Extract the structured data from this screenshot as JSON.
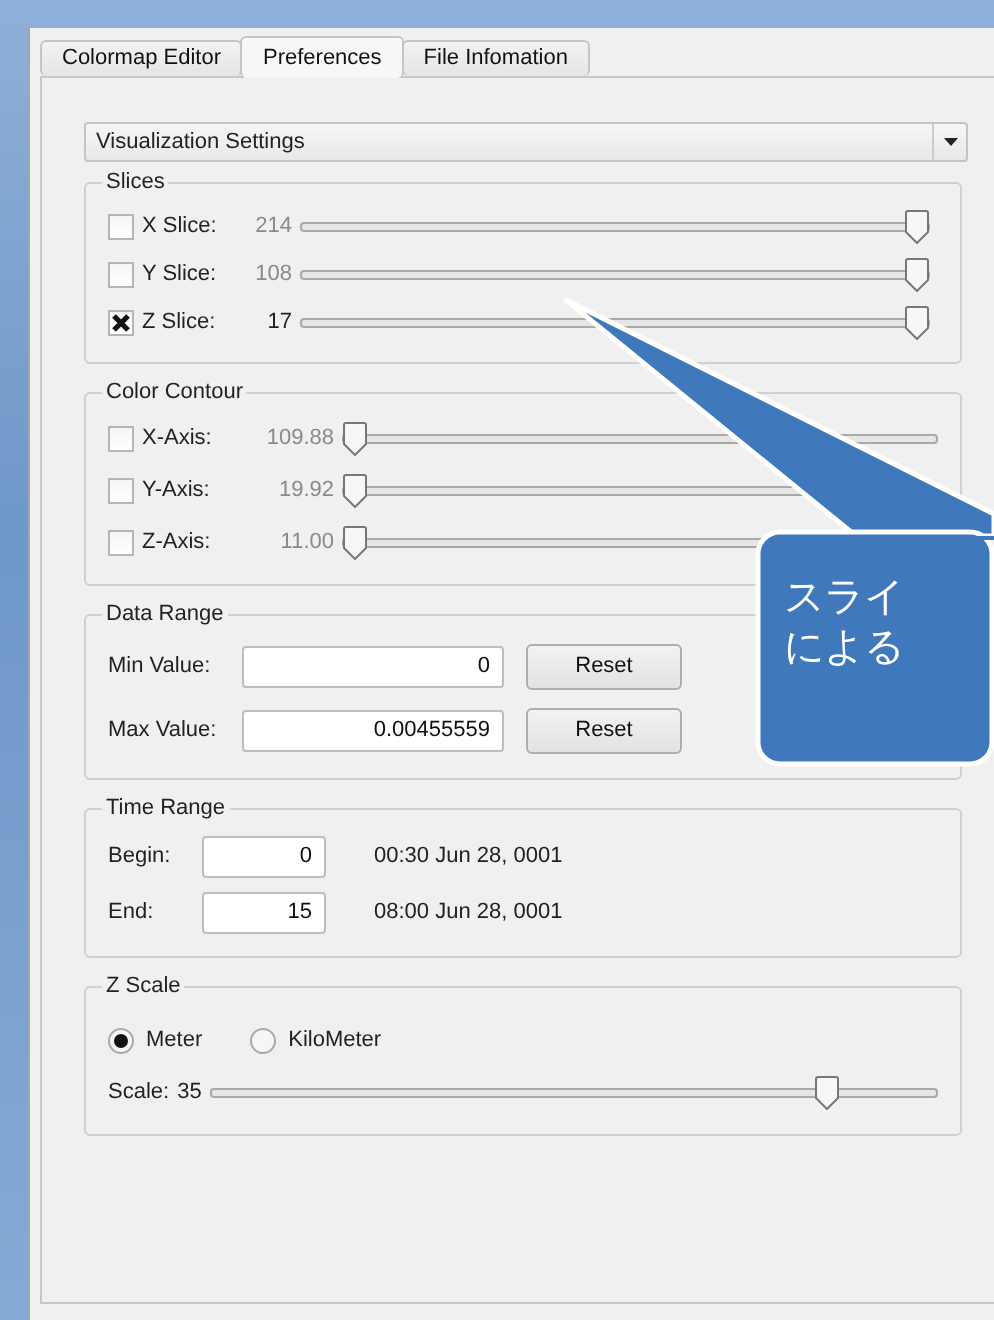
{
  "tabs": [
    {
      "label": "Colormap Editor",
      "selected": false
    },
    {
      "label": "Preferences",
      "selected": true
    },
    {
      "label": "File Infomation",
      "selected": false
    }
  ],
  "dropdown": {
    "value": "Visualization Settings"
  },
  "slices": {
    "title": "Slices",
    "rows": [
      {
        "label": "X Slice:",
        "value": "214",
        "checked": false,
        "level": 1
      },
      {
        "label": "Y Slice:",
        "value": "108",
        "checked": false,
        "level": 1
      },
      {
        "label": "Z Slice:",
        "value": "17",
        "checked": true,
        "level": 1
      }
    ]
  },
  "color_contour": {
    "title": "Color Contour",
    "rows": [
      {
        "label": "X-Axis:",
        "value": "109.88",
        "checked": false,
        "level": 0
      },
      {
        "label": "Y-Axis:",
        "value": "19.92",
        "checked": false,
        "level": 0
      },
      {
        "label": "Z-Axis:",
        "value": "11.00",
        "checked": false,
        "level": 0
      }
    ]
  },
  "data_range": {
    "title": "Data Range",
    "rows": [
      {
        "label": "Min Value:",
        "value": "0",
        "button": "Reset"
      },
      {
        "label": "Max Value:",
        "value": "0.00455559",
        "button": "Reset"
      }
    ]
  },
  "time_range": {
    "title": "Time Range",
    "rows": [
      {
        "label": "Begin:",
        "value": "0",
        "time": "00:30 Jun 28, 0001"
      },
      {
        "label": "End:",
        "value": "15",
        "time": "08:00 Jun 28, 0001"
      }
    ]
  },
  "z_scale": {
    "title": "Z Scale",
    "units": [
      {
        "label": "Meter",
        "selected": true
      },
      {
        "label": "KiloMeter",
        "selected": false
      }
    ],
    "scale_label": "Scale:",
    "scale_value": "35",
    "level": 0.86
  },
  "callout": {
    "lines": [
      "スライ",
      "による"
    ]
  }
}
